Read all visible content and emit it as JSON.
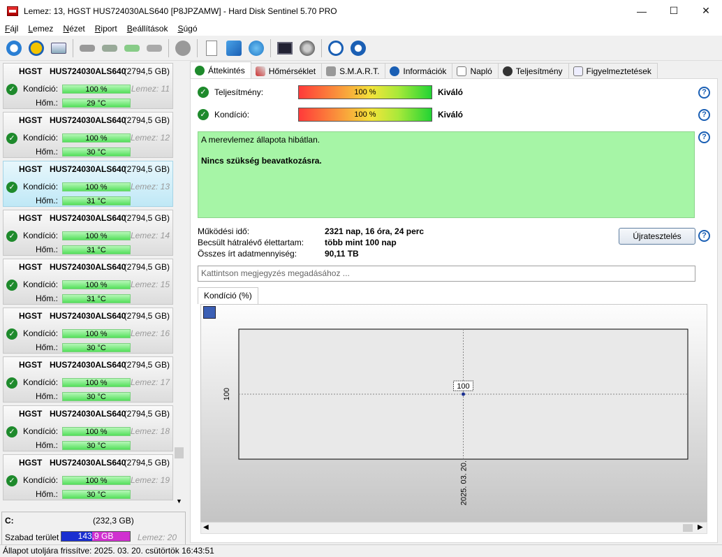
{
  "window": {
    "title": "Lemez: 13, HGST    HUS724030ALS640 [P8JPZAMW]  -  Hard Disk Sentinel 5.70 PRO",
    "minimize": "—",
    "maximize": "☐",
    "close": "✕"
  },
  "menu": [
    {
      "key": "F",
      "rest": "ájl"
    },
    {
      "key": "L",
      "rest": "emez"
    },
    {
      "key": "N",
      "rest": "ézet"
    },
    {
      "key": "R",
      "rest": "iport"
    },
    {
      "key": "B",
      "rest": "eállítások"
    },
    {
      "key": "S",
      "rest": "úgó"
    }
  ],
  "disks": [
    {
      "brand": "HGST",
      "model": "HUS724030ALS640",
      "size": "(2794,5 GB)",
      "cond_label": "Kondíció:",
      "cond": "100 %",
      "temp_label": "Hőm.:",
      "temp": "29 °C",
      "idx": "Lemez: 11",
      "selected": false
    },
    {
      "brand": "HGST",
      "model": "HUS724030ALS640",
      "size": "(2794,5 GB)",
      "cond_label": "Kondíció:",
      "cond": "100 %",
      "temp_label": "Hőm.:",
      "temp": "30 °C",
      "idx": "Lemez: 12",
      "selected": false
    },
    {
      "brand": "HGST",
      "model": "HUS724030ALS640",
      "size": "(2794,5 GB)",
      "cond_label": "Kondíció:",
      "cond": "100 %",
      "temp_label": "Hőm.:",
      "temp": "31 °C",
      "idx": "Lemez: 13",
      "selected": true
    },
    {
      "brand": "HGST",
      "model": "HUS724030ALS640",
      "size": "(2794,5 GB)",
      "cond_label": "Kondíció:",
      "cond": "100 %",
      "temp_label": "Hőm.:",
      "temp": "31 °C",
      "idx": "Lemez: 14",
      "selected": false
    },
    {
      "brand": "HGST",
      "model": "HUS724030ALS640",
      "size": "(2794,5 GB)",
      "cond_label": "Kondíció:",
      "cond": "100 %",
      "temp_label": "Hőm.:",
      "temp": "31 °C",
      "idx": "Lemez: 15",
      "selected": false
    },
    {
      "brand": "HGST",
      "model": "HUS724030ALS640",
      "size": "(2794,5 GB)",
      "cond_label": "Kondíció:",
      "cond": "100 %",
      "temp_label": "Hőm.:",
      "temp": "30 °C",
      "idx": "Lemez: 16",
      "selected": false
    },
    {
      "brand": "HGST",
      "model": "HUS724030ALS640",
      "size": "(2794,5 GB)",
      "cond_label": "Kondíció:",
      "cond": "100 %",
      "temp_label": "Hőm.:",
      "temp": "30 °C",
      "idx": "Lemez: 17",
      "selected": false
    },
    {
      "brand": "HGST",
      "model": "HUS724030ALS640",
      "size": "(2794,5 GB)",
      "cond_label": "Kondíció:",
      "cond": "100 %",
      "temp_label": "Hőm.:",
      "temp": "30 °C",
      "idx": "Lemez: 18",
      "selected": false
    },
    {
      "brand": "HGST",
      "model": "HUS724030ALS640",
      "size": "(2794,5 GB)",
      "cond_label": "Kondíció:",
      "cond": "100 %",
      "temp_label": "Hőm.:",
      "temp": "30 °C",
      "idx": "Lemez: 19",
      "selected": false
    }
  ],
  "partition": {
    "drive": "C:",
    "size": "(232,3 GB)",
    "free_label": "Szabad terület",
    "free_value": "143,9 GB",
    "idx": "Lemez: 20"
  },
  "tabs": [
    "Áttekintés",
    "Hőmérséklet",
    "S.M.A.R.T.",
    "Információk",
    "Napló",
    "Teljesítmény",
    "Figyelmeztetések"
  ],
  "overview": {
    "perf_label": "Teljesítmény:",
    "perf_value": "100 %",
    "perf_rating": "Kiváló",
    "cond_label": "Kondíció:",
    "cond_value": "100 %",
    "cond_rating": "Kiváló",
    "status_line1": "A merevlemez állapota hibátlan.",
    "status_line2": "Nincs szükség beavatkozásra.",
    "uptime_label": "Működési idő:",
    "uptime_value": "2321 nap, 16 óra, 24 perc",
    "lifetime_label": "Becsült hátralévő élettartam:",
    "lifetime_value": "több mint 100 nap",
    "written_label": "Összes írt adatmennyiség:",
    "written_value": "90,11 TB",
    "restart_button": "Újratesztelés",
    "note_placeholder": "Kattintson megjegyzés megadásához ..."
  },
  "chart_tab": "Kondíció  (%)",
  "chart_data": {
    "type": "line",
    "x": [
      "2025. 03. 20."
    ],
    "series": [
      {
        "values": [
          100
        ]
      }
    ],
    "y_tick_labels": [
      "100"
    ],
    "data_labels": [
      "100"
    ],
    "grid": true
  },
  "statusbar": "Állapot utoljára frissítve: 2025. 03. 20. csütörtök 16:43:51",
  "colors": {
    "green_check": "#1e8a2c",
    "status_bg": "#a6f5a6",
    "selected_item": "#bfe8f6",
    "help_blue": "#1a5fb4"
  }
}
